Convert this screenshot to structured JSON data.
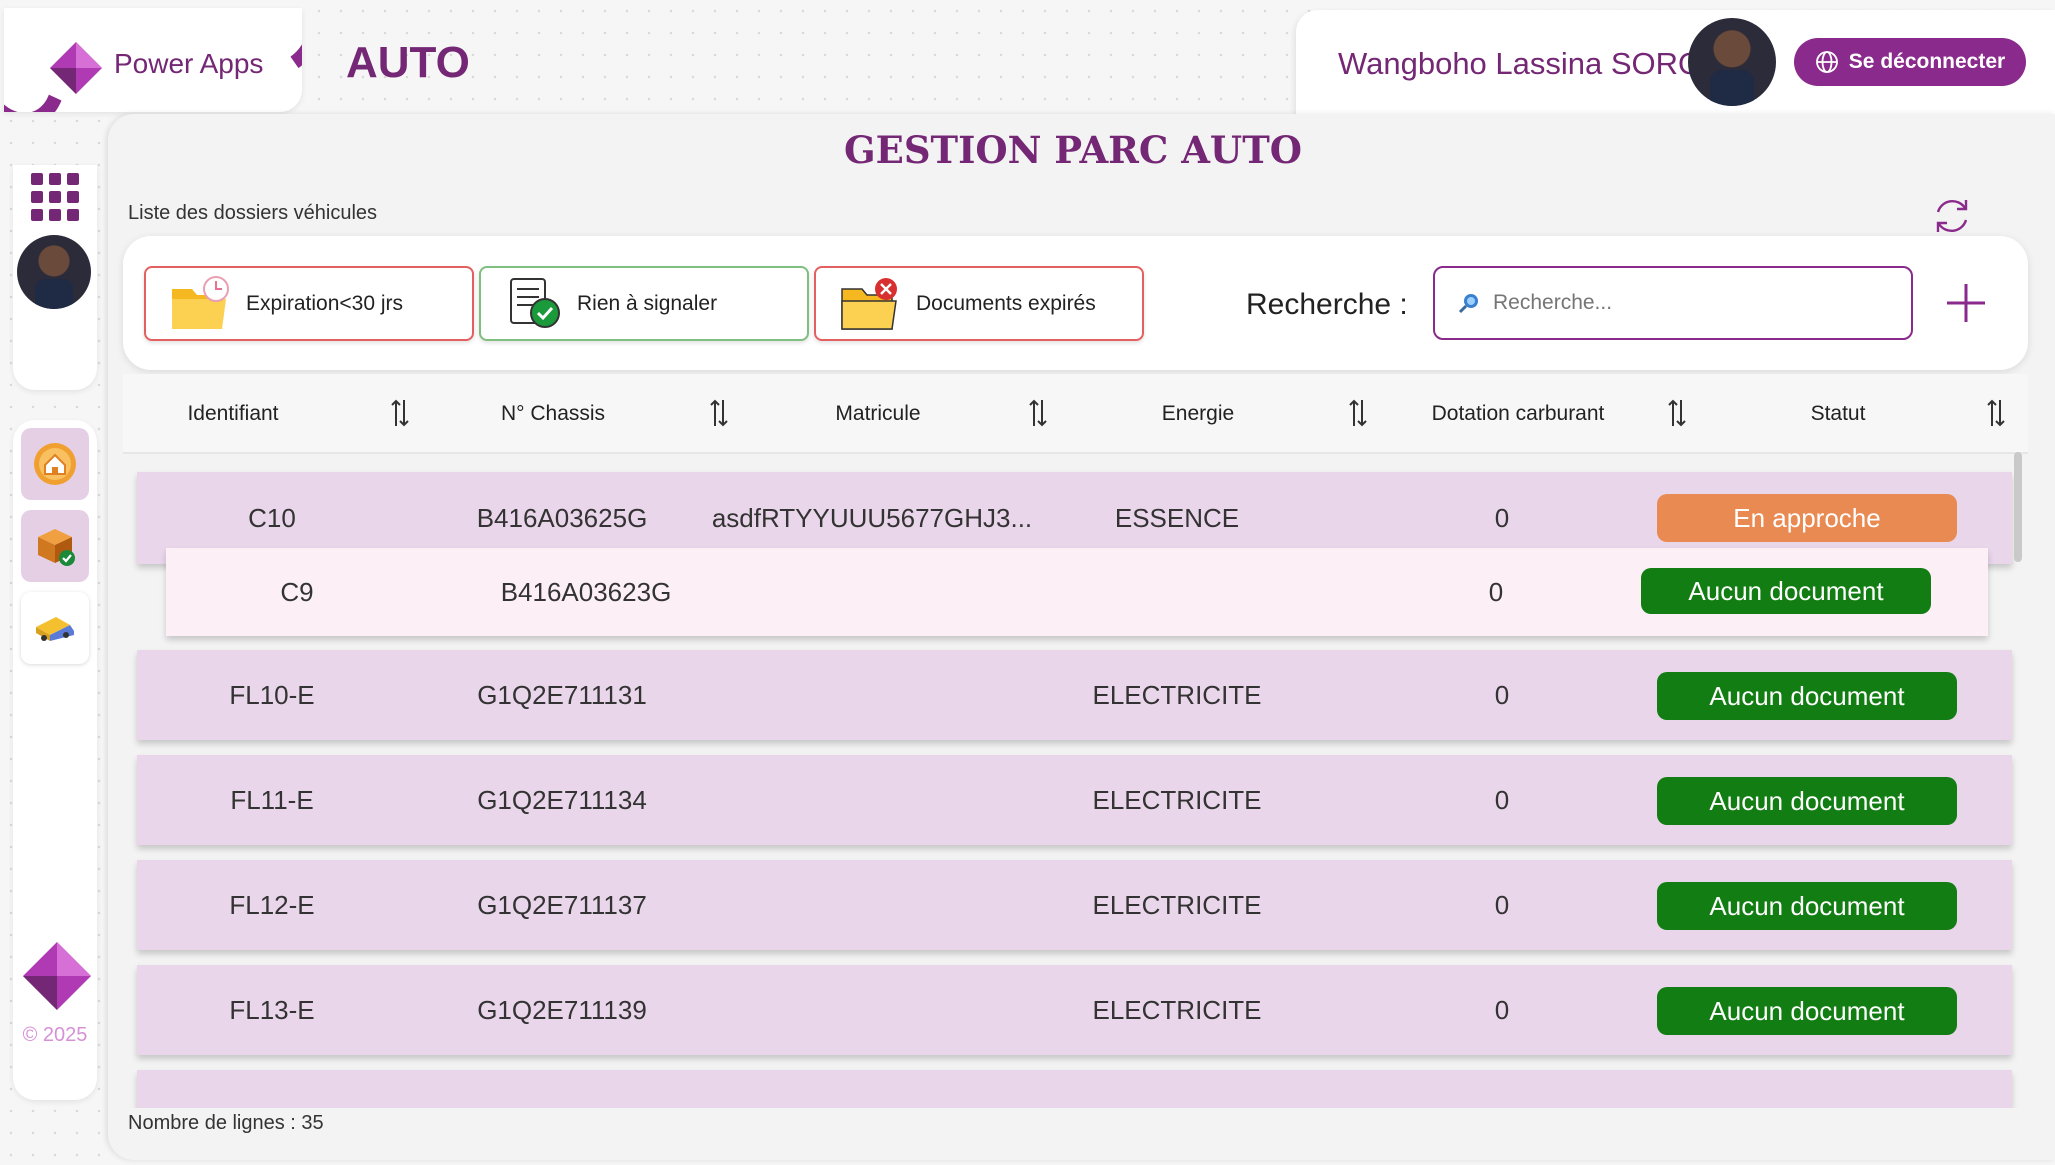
{
  "header": {
    "brand": "Power Apps",
    "app_title": "AUTO",
    "user_name": "Wangboho Lassina SORO",
    "logout_label": "Se déconnecter"
  },
  "sidebar": {
    "copyright": "© 2025",
    "items": [
      {
        "icon": "home-icon",
        "active": true
      },
      {
        "icon": "box-check-icon",
        "active": true
      },
      {
        "icon": "truck-icon",
        "active": false
      }
    ]
  },
  "main": {
    "title": "GESTION PARC AUTO",
    "list_label": "Liste des dossiers véhicules",
    "filters": [
      {
        "label": "Expiration<30 jrs",
        "icon": "folder-clock-icon",
        "border": "#e46060"
      },
      {
        "label": "Rien à signaler",
        "icon": "document-check-icon",
        "border": "#7fbf7f"
      },
      {
        "label": "Documents expirés",
        "icon": "folder-x-icon",
        "border": "#e46060"
      }
    ],
    "search_label": "Recherche :",
    "search_placeholder": "Recherche...",
    "columns": [
      "Identifiant",
      "N° Chassis",
      "Matricule",
      "Energie",
      "Dotation carburant",
      "Statut"
    ],
    "rows": [
      {
        "id": "C10",
        "chassis": "B416A03625G",
        "matricule": "asdfRTYYUUU5677GHJ3...",
        "energie": "ESSENCE",
        "dotation": "0",
        "statut": "En approche",
        "status_type": "warn"
      },
      {
        "id": "C9",
        "chassis": "B416A03623G",
        "matricule": "",
        "energie": "",
        "dotation": "0",
        "statut": "Aucun document",
        "status_type": "ok",
        "selected": true
      },
      {
        "id": "FL10-E",
        "chassis": "G1Q2E711131",
        "matricule": "",
        "energie": "ELECTRICITE",
        "dotation": "0",
        "statut": "Aucun document",
        "status_type": "ok"
      },
      {
        "id": "FL11-E",
        "chassis": "G1Q2E711134",
        "matricule": "",
        "energie": "ELECTRICITE",
        "dotation": "0",
        "statut": "Aucun document",
        "status_type": "ok"
      },
      {
        "id": "FL12-E",
        "chassis": "G1Q2E711137",
        "matricule": "",
        "energie": "ELECTRICITE",
        "dotation": "0",
        "statut": "Aucun document",
        "status_type": "ok"
      },
      {
        "id": "FL13-E",
        "chassis": "G1Q2E711139",
        "matricule": "",
        "energie": "ELECTRICITE",
        "dotation": "0",
        "statut": "Aucun document",
        "status_type": "ok"
      }
    ],
    "row_count": "Nombre de lignes : 35"
  },
  "colors": {
    "brand": "#742774",
    "accent": "#8a2a8c",
    "row_bg": "#ead6ea",
    "status_ok": "#127d12",
    "status_warn": "#e88a52"
  }
}
